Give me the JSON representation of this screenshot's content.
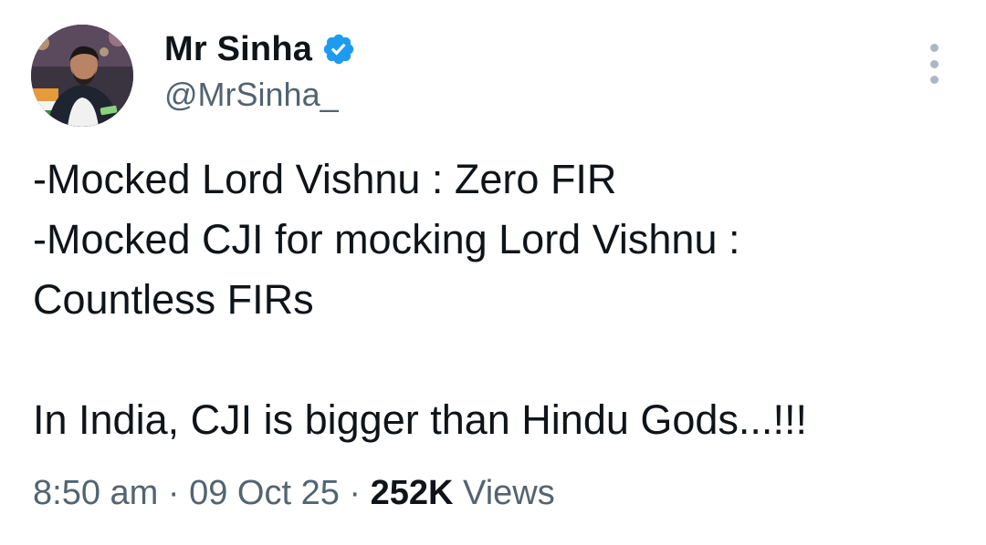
{
  "author": {
    "name": "Mr Sinha",
    "handle": "@MrSinha_",
    "verified": true,
    "verified_color": "#1d9bf0"
  },
  "tweet": {
    "lines": [
      "-Mocked Lord Vishnu : Zero FIR",
      "-Mocked CJI for mocking Lord Vishnu :",
      "Countless FIRs",
      "",
      "In India, CJI is bigger than Hindu Gods...!!!"
    ]
  },
  "meta": {
    "time": "8:50 am",
    "separator": "·",
    "date": "09 Oct 25",
    "views_count": "252K",
    "views_label": "Views"
  },
  "icons": {
    "verified": "verified-badge-icon",
    "more": "more-options-icon"
  }
}
